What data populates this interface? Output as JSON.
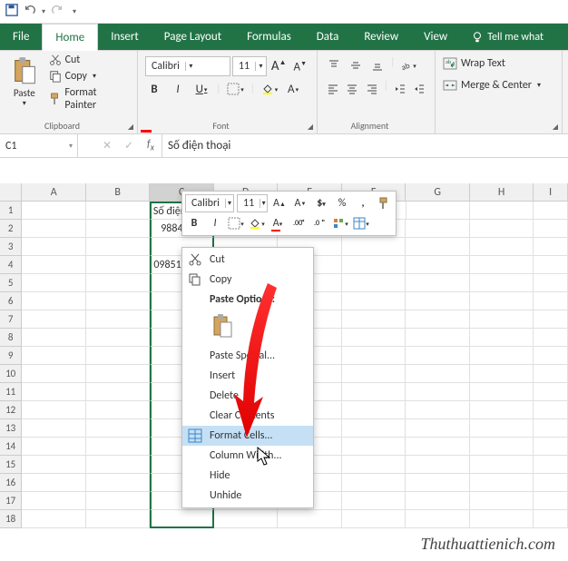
{
  "qat": {
    "save": "save-icon",
    "undo": "undo-icon",
    "redo": "redo-icon",
    "dropdown": "qat-dropdown"
  },
  "tabs": {
    "file": "File",
    "home": "Home",
    "insert": "Insert",
    "pageLayout": "Page Layout",
    "formulas": "Formulas",
    "data": "Data",
    "review": "Review",
    "view": "View",
    "tellme": "Tell me what"
  },
  "clipboard": {
    "paste": "Paste",
    "cut": "Cut",
    "copy": "Copy",
    "formatPainter": "Format Painter",
    "groupLabel": "Clipboard"
  },
  "font": {
    "name": "Calibri",
    "size": "11",
    "groupLabel": "Font"
  },
  "alignment": {
    "wrapText": "Wrap Text",
    "mergeCenter": "Merge & Center",
    "groupLabel": "Alignment"
  },
  "nameBox": "C1",
  "formulaValue": "Số điện thoại",
  "columns": [
    "A",
    "B",
    "C",
    "D",
    "E",
    "F",
    "G",
    "H",
    "I"
  ],
  "rows": [
    "1",
    "2",
    "3",
    "4",
    "5",
    "6",
    "7",
    "8",
    "9",
    "10",
    "11",
    "12",
    "13",
    "14",
    "15",
    "16",
    "17",
    "18"
  ],
  "cells": {
    "c1": "Số điện thoại",
    "c2": "988456789",
    "c4": "0985123456"
  },
  "miniToolbar": {
    "fontName": "Calibri",
    "fontSize": "11"
  },
  "contextMenu": {
    "cut": "Cut",
    "copy": "Copy",
    "pasteOptions": "Paste Options:",
    "pasteSpecial": "Paste Special...",
    "insert": "Insert",
    "delete": "Delete",
    "clearContents": "Clear Contents",
    "formatCells": "Format Cells...",
    "columnWidth": "Column Width...",
    "hide": "Hide",
    "unhide": "Unhide"
  },
  "watermark": "Thuthuattienich.com"
}
